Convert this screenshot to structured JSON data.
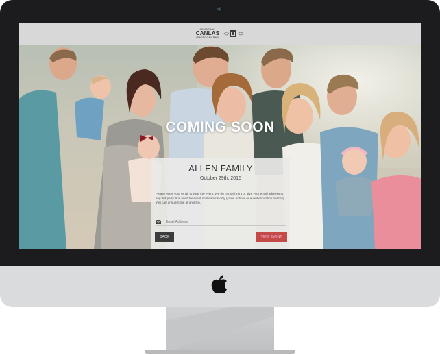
{
  "header": {
    "logo_line1": "JONATHAN",
    "logo_line2": "CANLAS",
    "logo_line3": "PHOTOGRAPHY"
  },
  "hero": {
    "headline": "COMING SOON"
  },
  "card": {
    "title": "ALLEN FAMILY",
    "date": "October 29th, 2015",
    "description": "Please enter your email to view the event. We do not sell, rent or give your email address to any 3rd party. It is used for event notifications only (sales notices or event expiration notices). You can unsubscribe at anytime.",
    "email_placeholder": "Email Address",
    "back_label": "BACK",
    "view_label": "VIEW EVENT"
  },
  "colors": {
    "accent": "#c44a48",
    "back_button": "#3c3c3c",
    "bezel": "#1c1c1e"
  },
  "icons": {
    "mail": "mail-icon",
    "apple": "apple-logo-icon",
    "camera": "webcam-icon"
  }
}
